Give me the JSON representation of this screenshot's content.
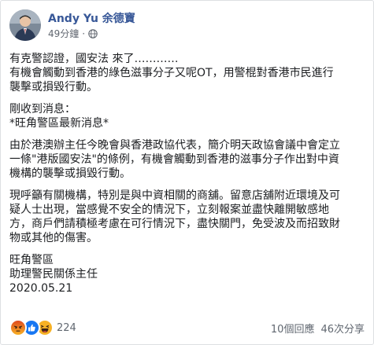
{
  "post": {
    "author": "Andy Yu 余德寶",
    "time": "49分鐘",
    "meta_separator": "·",
    "privacy_icon": "globe-icon",
    "paragraphs": [
      [
        "有克警認證，國安法 來了…………",
        "有機會觸動到香港的綠色滋事分子又呢OT，用警棍對香港市民進行",
        "襲擊或損毀行動。"
      ],
      [
        "剛收到消息：",
        "*旺角警區最新消息*"
      ],
      [
        "由於港澳辦主任今晚會與香港政協代表，簡介明天政協會議中會定立",
        "一條\"港版國安法\"的條例，有機會觸動到香港的滋事分子作出對中資",
        "機構的襲擊或損毀行動。"
      ],
      [
        "現呼籲有關機構，特別是與中資相關的商舖。留意店舖附近環境及可",
        "疑人士出現，當感覺不安全的情況下，立刻報案並盡快離開敏感地",
        "方，商戶們請積極考慮在可行情況下，盡快關門，免受波及而招致財",
        "物或其他的傷害。"
      ],
      [
        "旺角警區",
        "助理警民關係主任",
        "2020.05.21"
      ]
    ]
  },
  "footer": {
    "reaction_icons": [
      "angry-reaction-icon",
      "like-reaction-icon",
      "haha-reaction-icon"
    ],
    "reaction_count": "224",
    "comments": "10個回應",
    "shares": "46次分享"
  },
  "colors": {
    "author": "#385898",
    "meta": "#616770",
    "like": "#1877f2",
    "angry": "#e9710f",
    "haha": "#f7b125"
  }
}
